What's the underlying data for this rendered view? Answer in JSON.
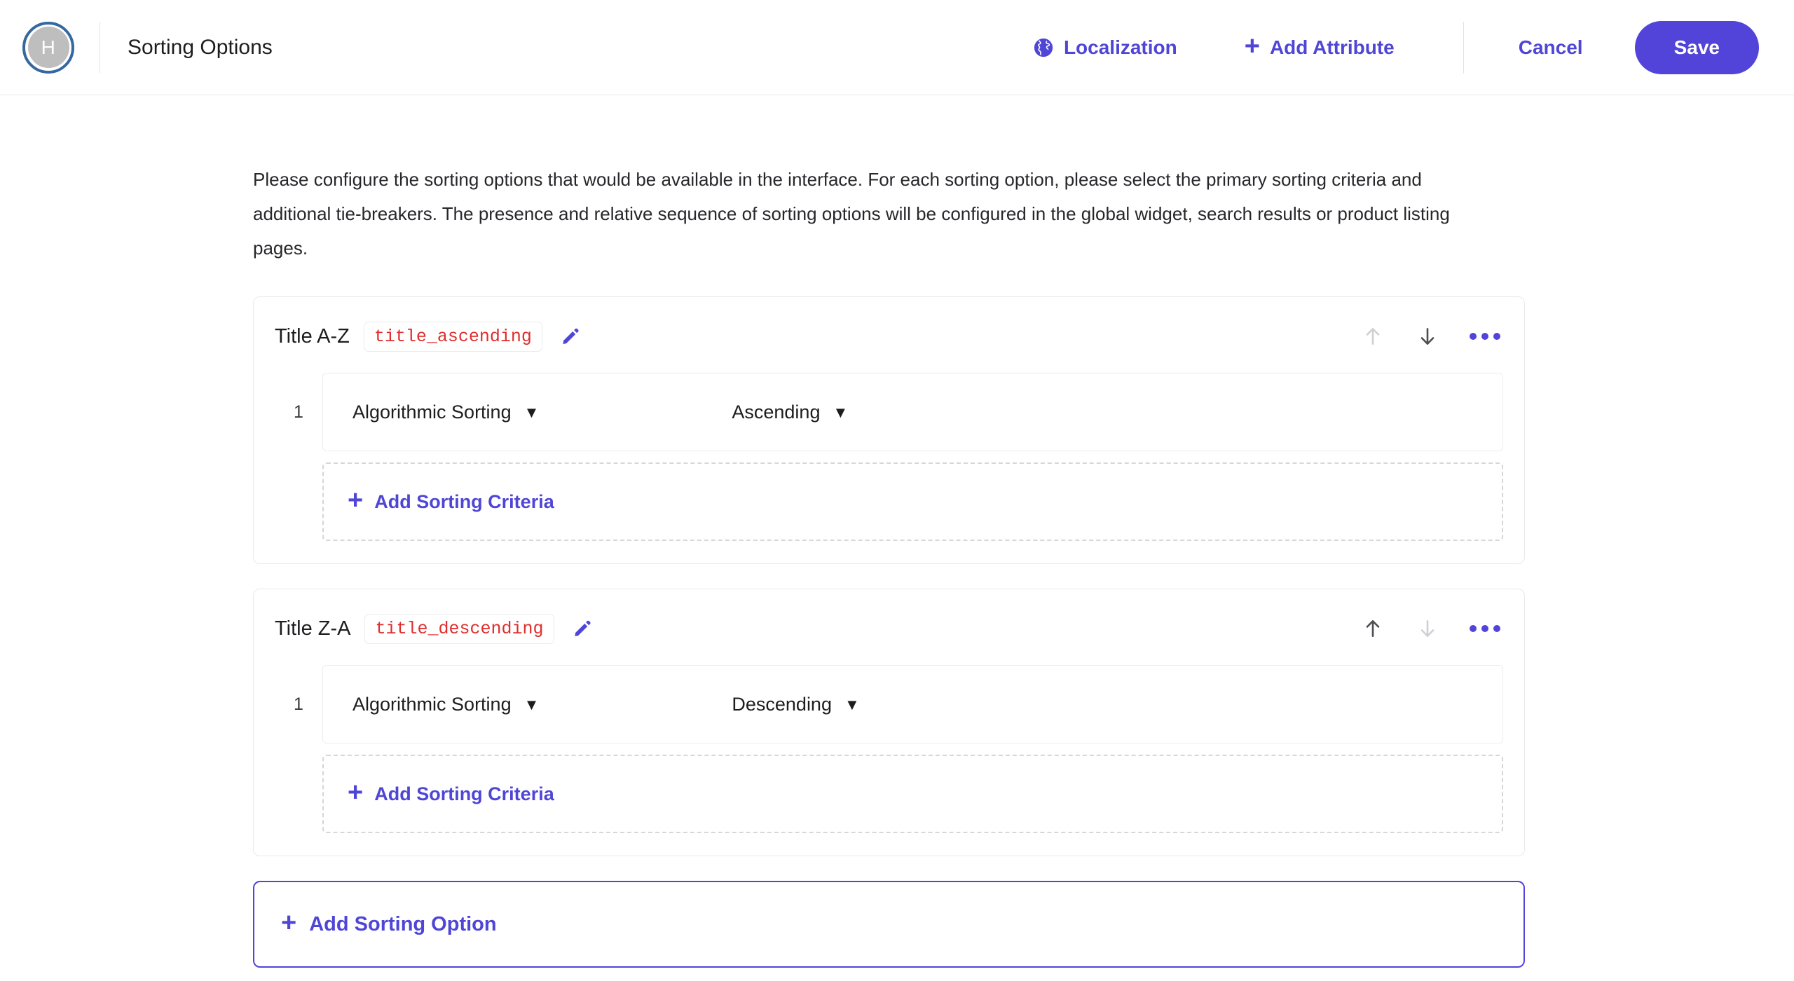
{
  "header": {
    "avatar_initial": "H",
    "title": "Sorting Options",
    "localization_label": "Localization",
    "localization_icon": "globe-icon",
    "add_attribute_label": "Add Attribute",
    "add_attribute_icon": "plus-icon",
    "cancel_label": "Cancel",
    "save_label": "Save",
    "accent_color": "#5243d9",
    "link_color": "#4f46d6",
    "avatar_ring_color": "#34689f",
    "avatar_fill_color": "#bebebe"
  },
  "main": {
    "intro": "Please configure the sorting options that would be available in the interface. For each sorting option, please select the primary sorting criteria and additional tie-breakers. The presence and relative sequence of sorting options will be configured in the global widget, search results or product listing pages.",
    "add_sorting_option_label": "Add Sorting Option",
    "add_sorting_criteria_label": "Add Sorting Criteria",
    "code_chip_color": "#e02d2d",
    "options": [
      {
        "name": "Title A-Z",
        "code": "title_ascending",
        "edit_icon": "pencil-icon",
        "move_up_enabled": false,
        "move_down_enabled": true,
        "criteria": [
          {
            "index": "1",
            "field": "Algorithmic Sorting",
            "direction": "Ascending"
          }
        ]
      },
      {
        "name": "Title Z-A",
        "code": "title_descending",
        "edit_icon": "pencil-icon",
        "move_up_enabled": true,
        "move_down_enabled": false,
        "criteria": [
          {
            "index": "1",
            "field": "Algorithmic Sorting",
            "direction": "Descending"
          }
        ]
      }
    ]
  }
}
